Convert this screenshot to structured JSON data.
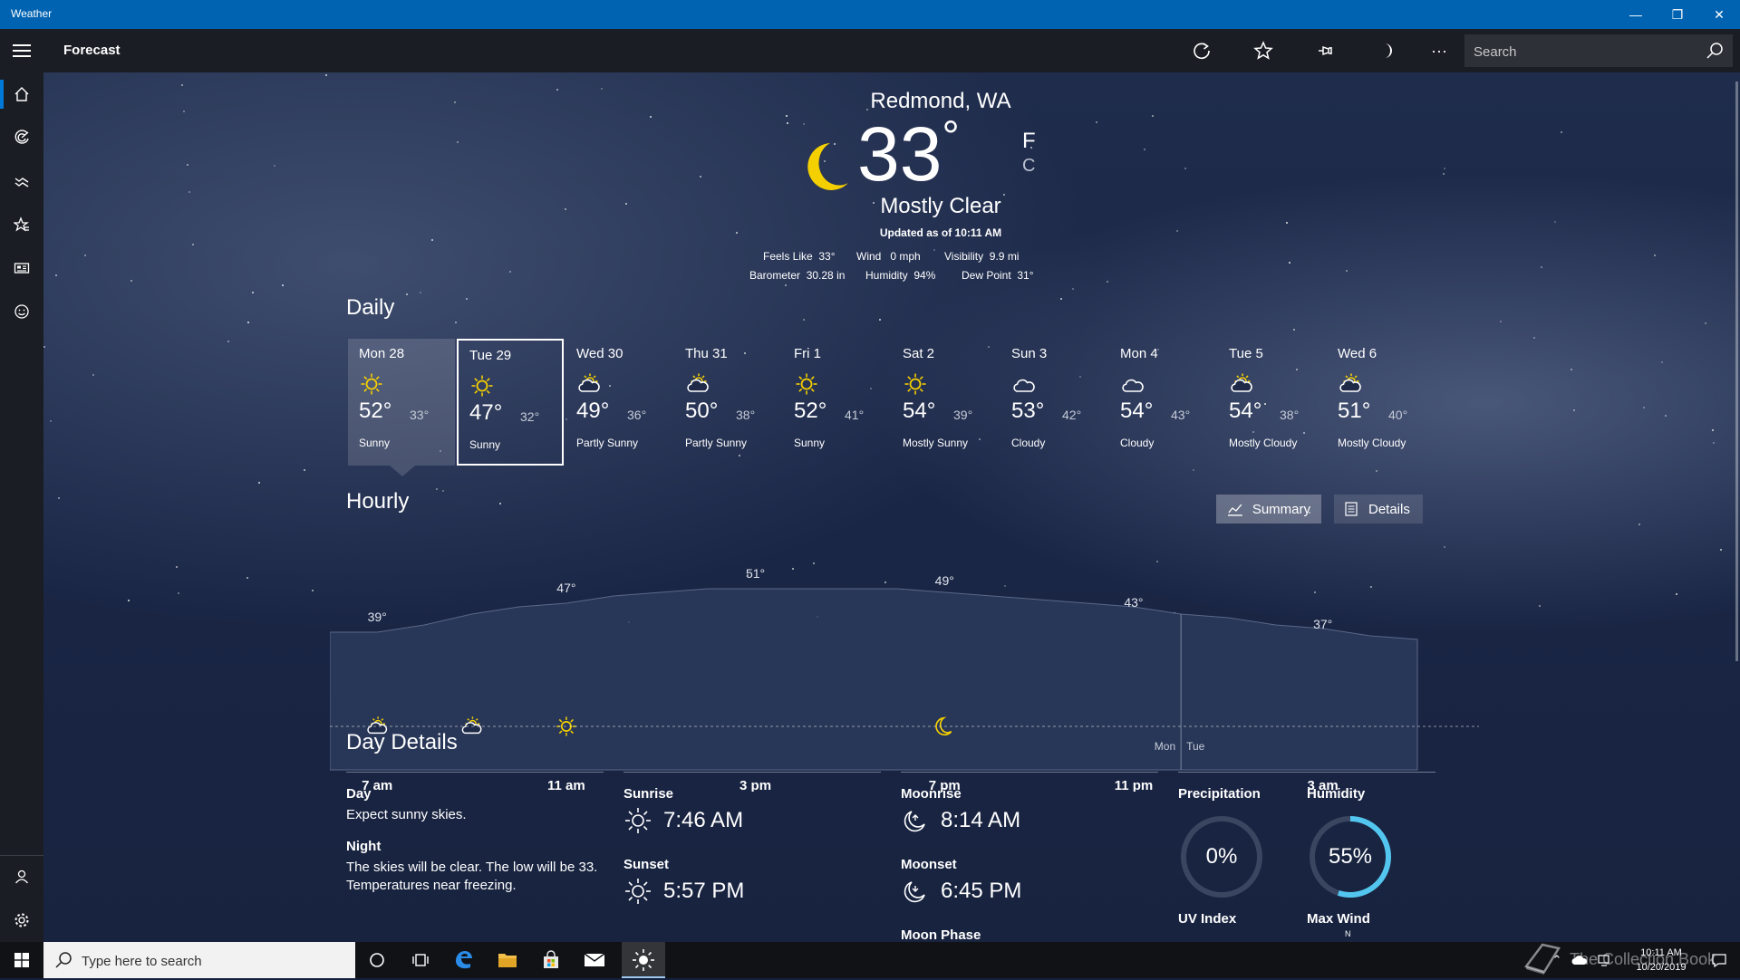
{
  "window": {
    "title": "Weather",
    "minimize": "—",
    "restore": "❐",
    "close": "✕"
  },
  "appbar": {
    "title": "Forecast",
    "search_placeholder": "Search"
  },
  "current": {
    "location": "Redmond, WA",
    "temperature": "33",
    "degree": "°",
    "unit_f": "F",
    "unit_c": "C",
    "condition": "Mostly Clear",
    "updated": "Updated as of 10:11 AM",
    "details_row1": [
      {
        "label": "Feels Like",
        "value": "33°"
      },
      {
        "label": "Wind",
        "value": "0 mph"
      },
      {
        "label": "Visibility",
        "value": "9.9 mi"
      }
    ],
    "details_row2": [
      {
        "label": "Barometer",
        "value": "30.28 in"
      },
      {
        "label": "Humidity",
        "value": "94%"
      },
      {
        "label": "Dew Point",
        "value": "31°"
      }
    ]
  },
  "daily": {
    "title": "Daily",
    "days": [
      {
        "name": "Mon 28",
        "icon": "sun-icon",
        "hi": "52°",
        "lo": "33°",
        "cond": "Sunny"
      },
      {
        "name": "Tue 29",
        "icon": "sun-icon",
        "hi": "47°",
        "lo": "32°",
        "cond": "Sunny"
      },
      {
        "name": "Wed 30",
        "icon": "partly-sunny-icon",
        "hi": "49°",
        "lo": "36°",
        "cond": "Partly Sunny"
      },
      {
        "name": "Thu 31",
        "icon": "partly-sunny-icon",
        "hi": "50°",
        "lo": "38°",
        "cond": "Partly Sunny"
      },
      {
        "name": "Fri 1",
        "icon": "sun-icon",
        "hi": "52°",
        "lo": "41°",
        "cond": "Sunny"
      },
      {
        "name": "Sat 2",
        "icon": "sun-icon",
        "hi": "54°",
        "lo": "39°",
        "cond": "Mostly Sunny"
      },
      {
        "name": "Sun 3",
        "icon": "cloud-icon",
        "hi": "53°",
        "lo": "42°",
        "cond": "Cloudy"
      },
      {
        "name": "Mon 4",
        "icon": "cloud-icon",
        "hi": "54°",
        "lo": "43°",
        "cond": "Cloudy"
      },
      {
        "name": "Tue 5",
        "icon": "mostly-cloudy-icon",
        "hi": "54°",
        "lo": "38°",
        "cond": "Mostly Cloudy"
      },
      {
        "name": "Wed 6",
        "icon": "mostly-cloudy-icon",
        "hi": "51°",
        "lo": "40°",
        "cond": "Mostly Cloudy"
      }
    ]
  },
  "hourly": {
    "title": "Hourly",
    "summary_label": "Summary",
    "details_label": "Details",
    "temp_labels": [
      "39°",
      "47°",
      "51°",
      "49°",
      "43°",
      "37°"
    ],
    "time_labels": [
      "7 am",
      "11 am",
      "3 pm",
      "7 pm",
      "11 pm",
      "3 am"
    ],
    "day_mon": "Mon",
    "day_tue": "Tue"
  },
  "chart_data": {
    "type": "area",
    "title": "",
    "x": [
      "6 am",
      "7 am",
      "8 am",
      "9 am",
      "10 am",
      "11 am",
      "12 pm",
      "1 pm",
      "2 pm",
      "3 pm",
      "4 pm",
      "5 pm",
      "6 pm",
      "7 pm",
      "8 pm",
      "9 pm",
      "10 pm",
      "11 pm",
      "12 am",
      "1 am",
      "2 am",
      "3 am",
      "4 am",
      "5 am"
    ],
    "series": [
      {
        "values": [
          39,
          39,
          41,
          44,
          46,
          47,
          49,
          50,
          51,
          51,
          51,
          51,
          51,
          50,
          49,
          48,
          47,
          46,
          44,
          43,
          41,
          40,
          38,
          37
        ]
      }
    ],
    "labeled_points": [
      {
        "x": "7 am",
        "y": 39
      },
      {
        "x": "11 am",
        "y": 47
      },
      {
        "x": "3 pm",
        "y": 51
      },
      {
        "x": "7 pm",
        "y": 49
      },
      {
        "x": "11 pm",
        "y": 43
      },
      {
        "x": "3 am",
        "y": 37
      }
    ],
    "condition_icons": [
      {
        "x": "7 am",
        "icon": "partly-cloudy-icon"
      },
      {
        "x": "9 am",
        "icon": "partly-sunny-icon"
      },
      {
        "x": "11 am",
        "icon": "sun-icon"
      },
      {
        "x": "7 pm",
        "icon": "moon-icon"
      }
    ],
    "ylim": [
      30,
      55
    ],
    "xlabel": "",
    "ylabel": ""
  },
  "day_details": {
    "title": "Day Details",
    "day_label": "Day",
    "day_text": "Expect sunny skies.",
    "night_label": "Night",
    "night_text_1": "The skies will be clear. The low will be 33.",
    "night_text_2": "Temperatures near freezing.",
    "sunrise_label": "Sunrise",
    "sunrise": "7:46 AM",
    "sunset_label": "Sunset",
    "sunset": "5:57 PM",
    "moonrise_label": "Moonrise",
    "moonrise": "8:14 AM",
    "moonset_label": "Moonset",
    "moonset": "6:45 PM",
    "moonphase_label": "Moon Phase",
    "precip_label": "Precipitation",
    "precip": "0%",
    "precip_fraction": 0,
    "humidity_label": "Humidity",
    "humidity": "55%",
    "humidity_fraction": 0.55,
    "uv_label": "UV Index",
    "maxwind_label": "Max Wind",
    "compass_n": "N"
  },
  "taskbar": {
    "search_placeholder": "Type here to search",
    "time": "10:11 AM",
    "date": "10/20/2019",
    "watermark": "The Collection Book"
  },
  "colors": {
    "accent": "#0078d7",
    "titlebar": "#0063b1",
    "sun": "#f5d000",
    "gauge": "#53c6f0"
  }
}
